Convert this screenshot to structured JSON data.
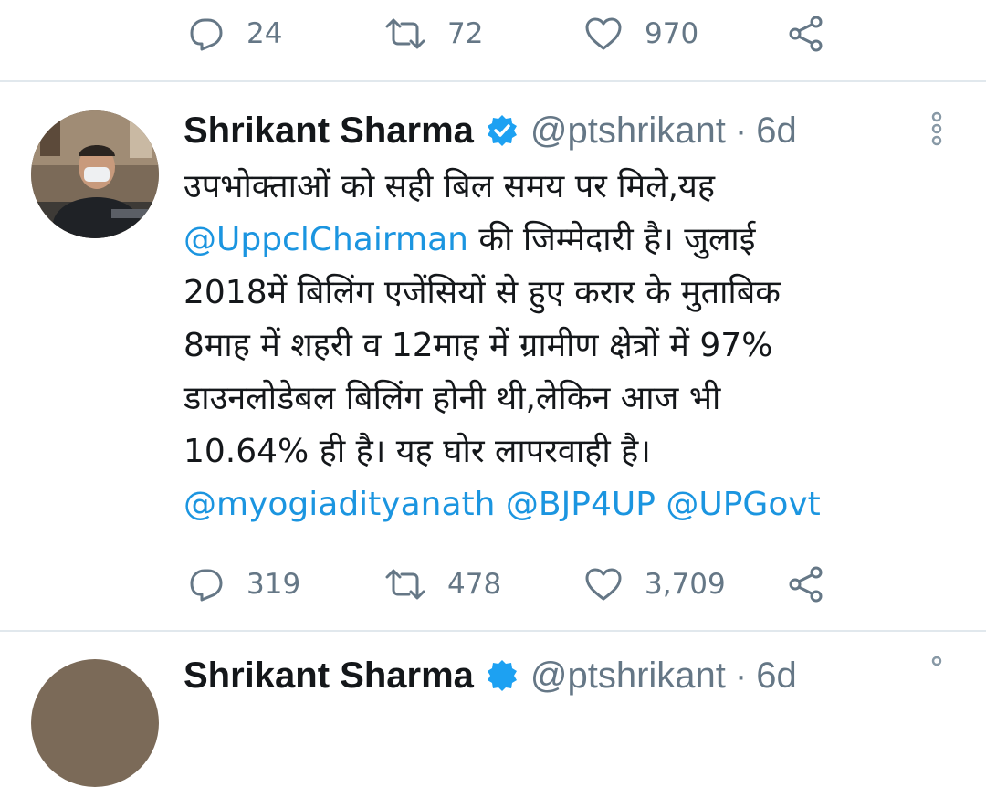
{
  "prev_tweet": {
    "actions": {
      "replies": "24",
      "retweets": "72",
      "likes": "970"
    }
  },
  "tweet": {
    "author_name": "Shrikant Sharma",
    "handle": "@ptshrikant",
    "separator": "·",
    "time": "6d",
    "text_lines": [
      {
        "parts": [
          {
            "t": "उपभोक्ताओं को सही बिल समय पर मिले,यह",
            "m": false
          }
        ]
      },
      {
        "parts": [
          {
            "t": "@UppclChairman",
            "m": true
          },
          {
            "t": " की जिम्मेदारी है। जुलाई",
            "m": false
          }
        ]
      },
      {
        "parts": [
          {
            "t": "2018में बिलिंग एजेंसियों से हुए करार के मुताबिक",
            "m": false
          }
        ]
      },
      {
        "parts": [
          {
            "t": "8माह में शहरी व 12माह में ग्रामीण क्षेत्रों में 97%",
            "m": false
          }
        ]
      },
      {
        "parts": [
          {
            "t": "डाउनलोडेबल बिलिंग होनी थी,लेकिन आज भी",
            "m": false
          }
        ]
      },
      {
        "parts": [
          {
            "t": "10.64% ही है। यह घोर लापरवाही है।",
            "m": false
          }
        ]
      },
      {
        "parts": [
          {
            "t": "@myogiadityanath",
            "m": true
          },
          {
            "t": " ",
            "m": false
          },
          {
            "t": "@BJP4UP",
            "m": true
          },
          {
            "t": " ",
            "m": false
          },
          {
            "t": "@UPGovt",
            "m": true
          }
        ]
      }
    ],
    "actions": {
      "replies": "319",
      "retweets": "478",
      "likes": "3,709"
    }
  },
  "next_tweet": {
    "author_name": "Shrikant Sharma",
    "handle": "@ptshrikant",
    "separator": "·",
    "time": "6d"
  },
  "colors": {
    "link": "#1b95e0",
    "muted": "#657786",
    "text": "#14171a",
    "divider": "#e1e8ed"
  },
  "icons": [
    "reply-icon",
    "retweet-icon",
    "like-icon",
    "share-icon",
    "verified-badge-icon",
    "more-options-icon"
  ]
}
